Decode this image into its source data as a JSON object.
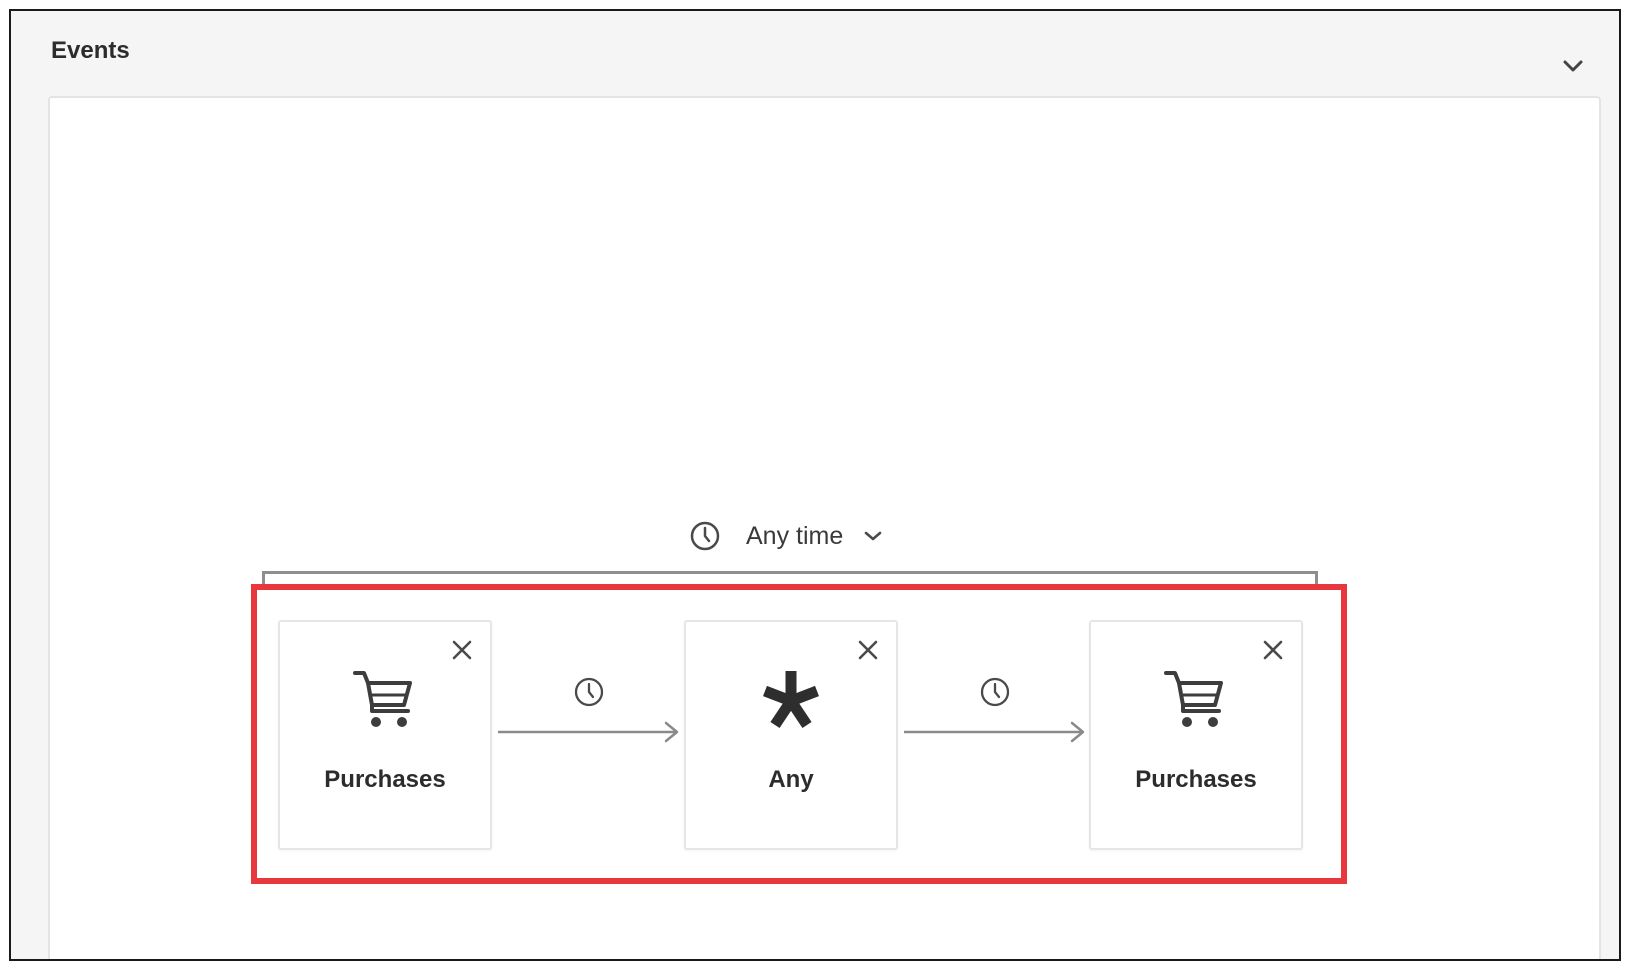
{
  "panel": {
    "title": "Events",
    "collapse_icon": "chevron-down-icon"
  },
  "time_selector": {
    "icon": "clock-icon",
    "label": "Any time",
    "dropdown_icon": "chevron-down-icon"
  },
  "sequence": {
    "highlight_color": "#e8383e",
    "events": [
      {
        "label": "Purchases",
        "icon": "shopping-cart-icon",
        "remove_icon": "close-icon"
      },
      {
        "label": "Any",
        "icon": "asterisk-icon",
        "remove_icon": "close-icon"
      },
      {
        "label": "Purchases",
        "icon": "shopping-cart-icon",
        "remove_icon": "close-icon"
      }
    ],
    "connectors": [
      {
        "icon": "clock-icon",
        "arrow": "arrow-right-icon"
      },
      {
        "icon": "clock-icon",
        "arrow": "arrow-right-icon"
      }
    ]
  }
}
